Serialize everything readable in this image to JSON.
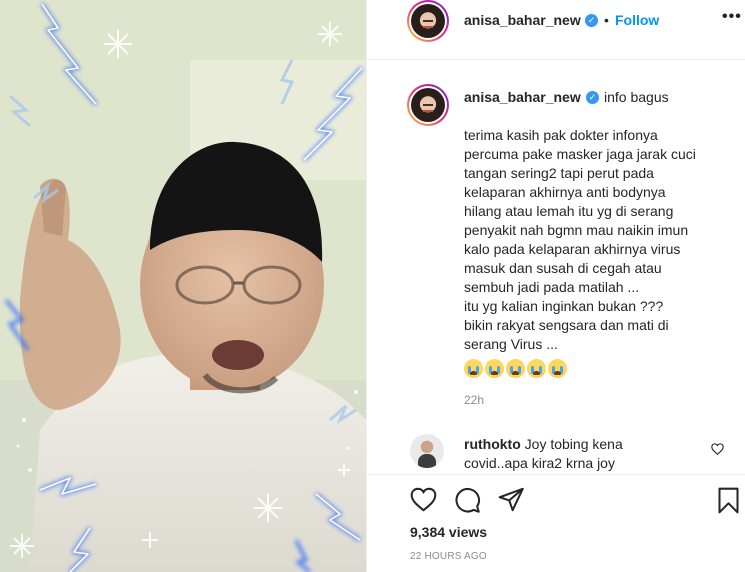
{
  "post": {
    "username": "anisa_bahar_new",
    "follow_label": "Follow",
    "separator": "•",
    "more_label": "•••"
  },
  "caption": {
    "username": "anisa_bahar_new",
    "short_text": "info bagus",
    "lines": [
      "terima kasih pak dokter infonya",
      "percuma pake masker jaga jarak cuci",
      "tangan sering2 tapi perut pada",
      "kelaparan akhirnya anti bodynya",
      "hilang atau lemah itu yg di serang",
      "penyakit nah bgmn mau naikin imun",
      "kalo pada kelaparan akhirnya virus",
      "masuk dan susah di cegah atau",
      "sembuh jadi pada matilah ...",
      "itu yg kalian inginkan bukan ???",
      "bikin rakyat sengsara dan mati di",
      "serang Virus ..."
    ],
    "emoji_count": 5,
    "time": "22h"
  },
  "comment": {
    "username": "ruthokto",
    "text_line1": "Joy tobing kena",
    "text_line2": "covid..apa kira2 krna joy"
  },
  "stats": {
    "views": "9,384 views",
    "time_ago": "22 HOURS AGO"
  },
  "colors": {
    "accent": "#0095f6",
    "verified": "#3897f0",
    "muted": "#8e8e8e",
    "lightning": "#2f6bff"
  }
}
